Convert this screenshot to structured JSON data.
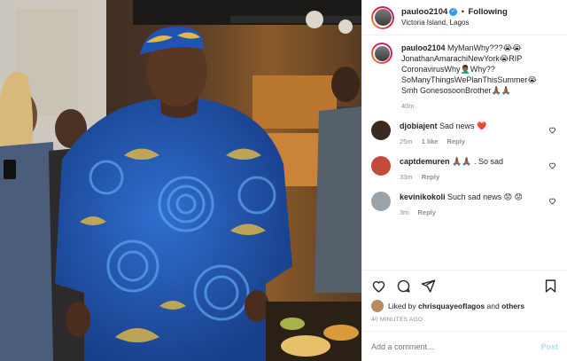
{
  "header": {
    "username": "pauloo2104",
    "verified_glyph": "✓",
    "separator": "•",
    "follow_state": "Following",
    "location": "Victoria Island, Lagos"
  },
  "caption": {
    "username": "pauloo2104",
    "text": "MyManWhy???😭😭 JonathanAmarachiNewYork😭RIP CoronavirusWhy🤦🏾‍♂️Why?? SoManyThingsWePlanThisSummer😭 Smh GonesosoonBrother🙏🏾🙏🏾",
    "time": "40m"
  },
  "comments": [
    {
      "username": "djobiajent",
      "text": "Sad news ❤️",
      "time": "25m",
      "likes": "1 like",
      "reply": "Reply"
    },
    {
      "username": "captdemuren",
      "text": "🙏🏾🙏🏾 . So sad",
      "time": "33m",
      "likes": "",
      "reply": "Reply"
    },
    {
      "username": "kevinikokoli",
      "text": "Such sad news 😟 😟",
      "time": "3m",
      "likes": "",
      "reply": "Reply"
    }
  ],
  "actions": {
    "like_icon": "heart-icon",
    "comment_icon": "comment-icon",
    "share_icon": "share-icon",
    "save_icon": "bookmark-icon"
  },
  "likes": {
    "prefix": "Liked by",
    "user": "chrisquayeoflagos",
    "conj": "and",
    "others": "others"
  },
  "timestamp": "40 MINUTES AGO",
  "composer": {
    "placeholder": "Add a comment...",
    "post_label": "Post"
  },
  "colors": {
    "verified": "#3897f0",
    "post_button_disabled": "#b3dbff",
    "muted_text": "#8e8e8e"
  }
}
